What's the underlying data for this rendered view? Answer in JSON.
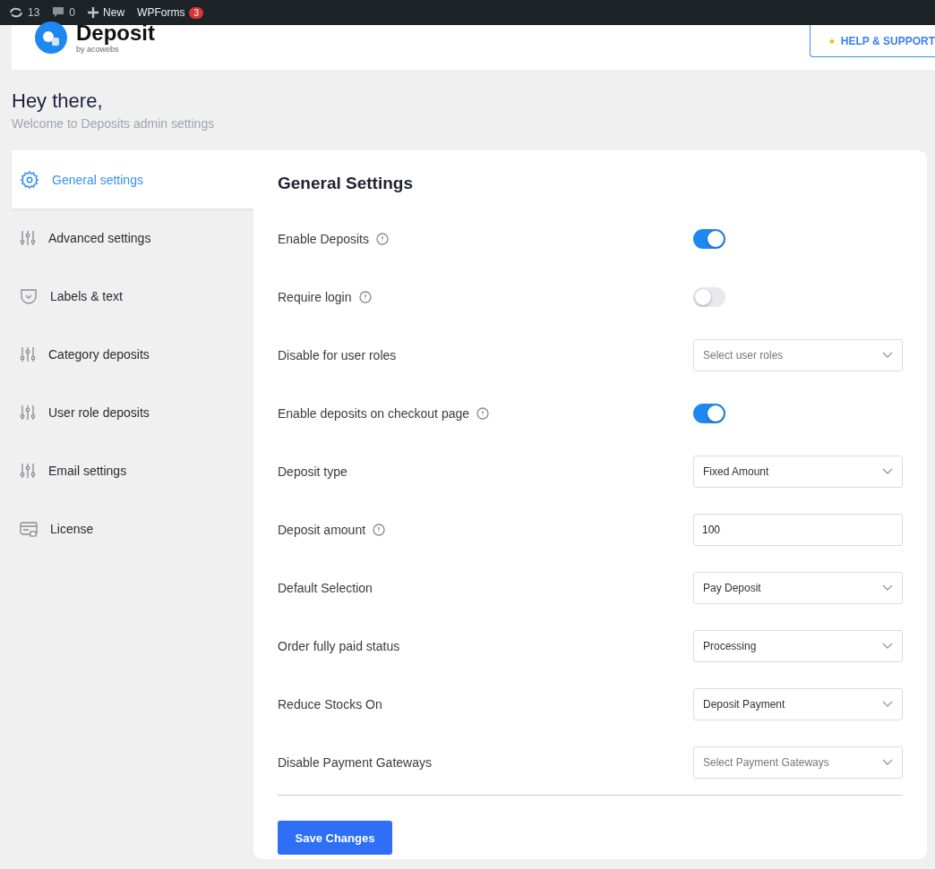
{
  "admin_bar": {
    "updates": "13",
    "comments": "0",
    "new": "New",
    "wpforms": "WPForms",
    "wpforms_badge": "3"
  },
  "header": {
    "logo_title": "Deposit",
    "logo_subtitle": "by acowebs",
    "help_button": "HELP & SUPPORT"
  },
  "greeting": {
    "title": "Hey there,",
    "subtitle": "Welcome to Deposits admin settings"
  },
  "sidebar": {
    "items": [
      {
        "label": "General settings",
        "kind": "gear",
        "selected": true
      },
      {
        "label": "Advanced settings",
        "kind": "sliders",
        "selected": false
      },
      {
        "label": "Labels & text",
        "kind": "pocket",
        "selected": false
      },
      {
        "label": "Category deposits",
        "kind": "sliders",
        "selected": false
      },
      {
        "label": "User role deposits",
        "kind": "sliders",
        "selected": false
      },
      {
        "label": "Email settings",
        "kind": "sliders",
        "selected": false
      },
      {
        "label": "License",
        "kind": "license",
        "selected": false
      }
    ]
  },
  "panel": {
    "title": "General Settings",
    "rows": [
      {
        "label": "Enable Deposits",
        "info": true,
        "kind": "toggle",
        "on": true
      },
      {
        "label": "Require login",
        "info": true,
        "kind": "toggle",
        "on": false
      },
      {
        "label": "Disable for user roles",
        "info": false,
        "kind": "select",
        "placeholder": "Select user roles"
      },
      {
        "label": "Enable deposits on checkout page",
        "info": true,
        "kind": "toggle",
        "on": true
      },
      {
        "label": "Deposit type",
        "info": false,
        "kind": "select",
        "value": "Fixed Amount"
      },
      {
        "label": "Deposit amount",
        "info": true,
        "kind": "input",
        "value": "100"
      },
      {
        "label": "Default Selection",
        "info": false,
        "kind": "select",
        "value": "Pay Deposit"
      },
      {
        "label": "Order fully paid status",
        "info": false,
        "kind": "select",
        "value": "Processing"
      },
      {
        "label": "Reduce Stocks On",
        "info": false,
        "kind": "select",
        "value": "Deposit Payment"
      },
      {
        "label": "Disable Payment Gateways",
        "info": false,
        "kind": "select",
        "placeholder": "Select Payment Gateways"
      }
    ],
    "save_button": "Save Changes"
  }
}
